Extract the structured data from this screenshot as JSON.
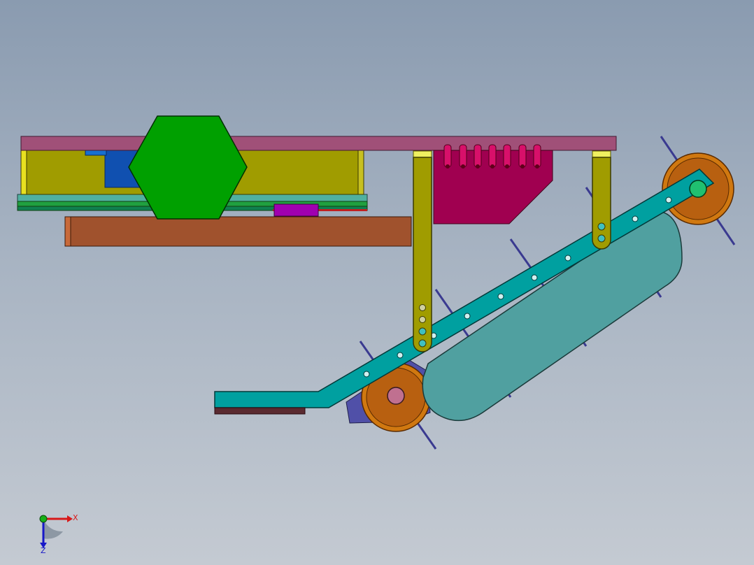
{
  "viewport": {
    "background_top": "#8a9bb0",
    "background_bottom": "#c4cad2"
  },
  "triad": {
    "x_label": "X",
    "z_label": "Z",
    "x_color": "#d81818",
    "y_color": "#18b018",
    "z_color": "#1818c8"
  },
  "parts": {
    "top_plate_color": "#a05078",
    "motor_housing_color": "#a09c00",
    "hex_nut_color": "#00a000",
    "lower_beam_color": "#a0522d",
    "block_color": "#a00050",
    "hanger_color": "#a09c00",
    "belt_frame_color": "#00a0a0",
    "belt_cover_color": "#50a0a0",
    "pulley_color": "#d07810",
    "idler_plate_color": "#5050a8",
    "foot_color": "#00a0a0"
  }
}
